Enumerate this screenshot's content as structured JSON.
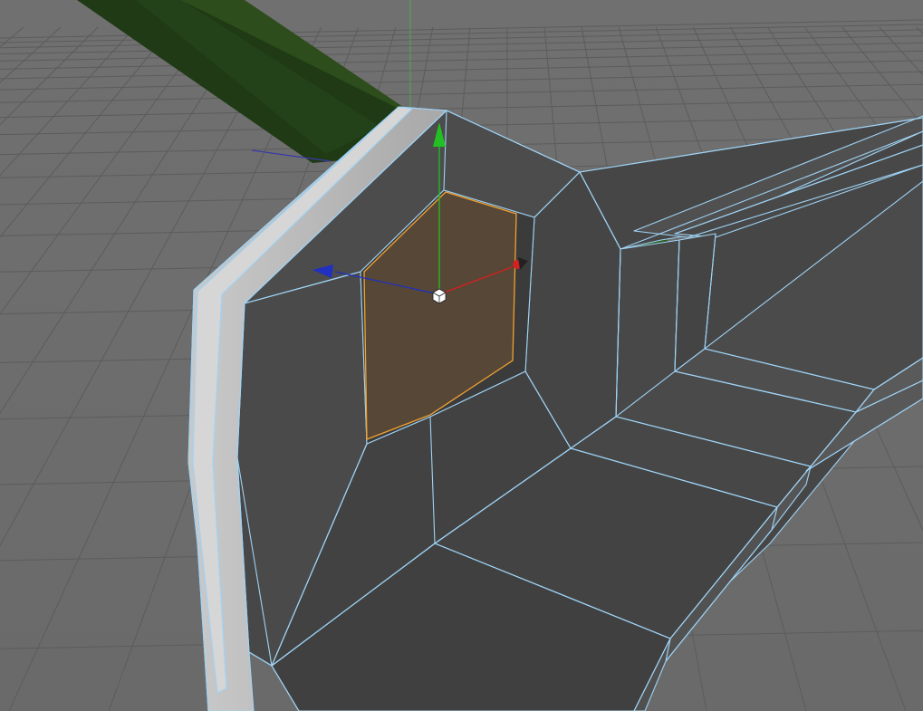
{
  "viewport": {
    "view": "perspective",
    "background_color": "#6b6b6b",
    "grid_color": "#5c5c5c",
    "grid": true
  },
  "mesh": {
    "object": "wall-with-window-opening",
    "face_color": "#454545",
    "lit_face_color": "#b9b9b9",
    "edge_color": "#9fd3f5",
    "selected_face_color": "#5a4a38",
    "selected_edge_color": "#f0a030"
  },
  "background_object": {
    "color": "#2a4a1c"
  },
  "gizmo": {
    "mode": "move",
    "axis_colors": {
      "x": "#d42020",
      "y": "#20c020",
      "z": "#2030c0"
    },
    "pivot_icon": "pivot-cube-icon"
  }
}
